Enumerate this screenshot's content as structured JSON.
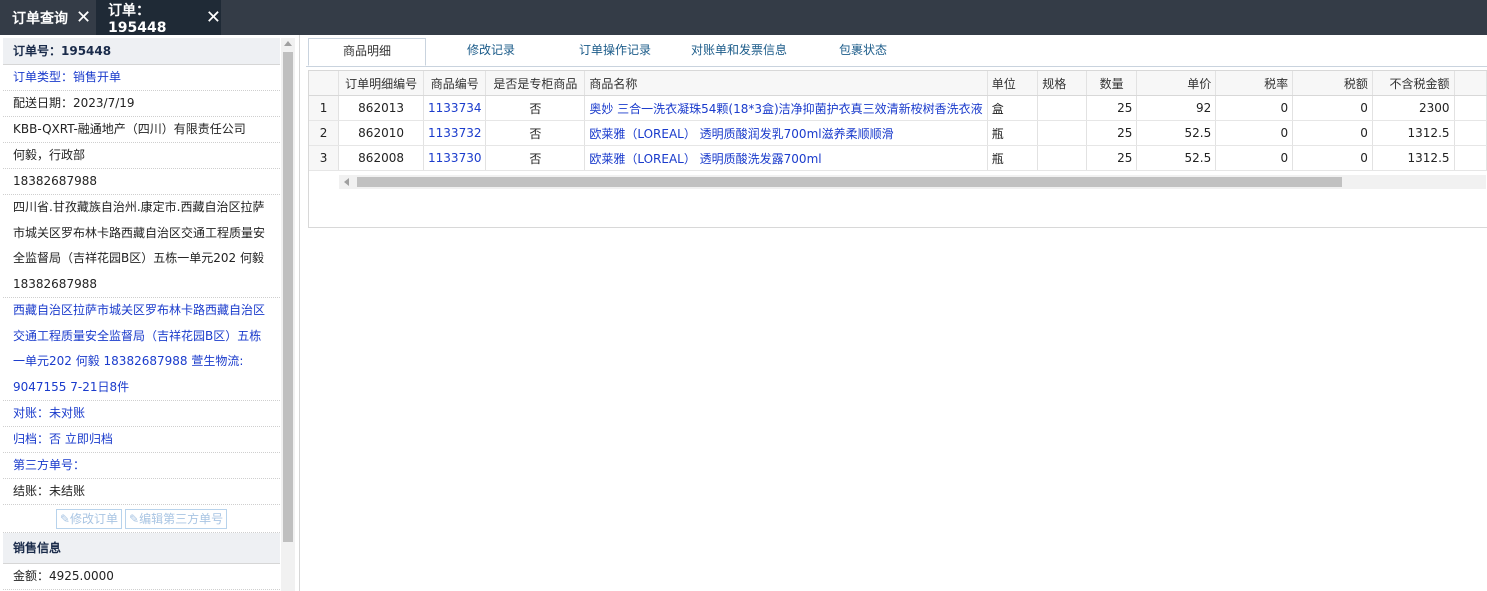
{
  "tabs": [
    {
      "label": "订单查询"
    },
    {
      "label": "订单：195448"
    }
  ],
  "sidebar": {
    "header": "订单号：195448",
    "order_type": "订单类型：销售开单",
    "delivery_date": "配送日期：2023/7/19",
    "company": "KBB-QXRT-融通地产（四川）有限责任公司",
    "contact": "何毅，行政部",
    "phone": "18382687988",
    "address_lines": [
      "四川省.甘孜藏族自治州.康定市.西藏自治区拉萨",
      "市城关区罗布林卡路西藏自治区交通工程质量安",
      "全监督局（吉祥花园B区）五栋一单元202 何毅",
      "18382687988"
    ],
    "remark_lines": [
      "西藏自治区拉萨市城关区罗布林卡路西藏自治区",
      "交通工程质量安全监督局（吉祥花园B区）五栋",
      "一单元202 何毅 18382687988 萱生物流:",
      "9047155 7-21日8件"
    ],
    "reconcile": "对账：未对账",
    "archive": "归档：否 立即归档",
    "third_party": "第三方单号：",
    "settle": "结账：未结账",
    "edit_order_btn": "修改订单",
    "edit_third_btn": "编辑第三方单号",
    "sales_section": "销售信息",
    "amount": "金额：4925.0000"
  },
  "panel_tabs": [
    {
      "label": "商品明细"
    },
    {
      "label": "修改记录"
    },
    {
      "label": "订单操作记录"
    },
    {
      "label": "对账单和发票信息"
    },
    {
      "label": "包裹状态"
    }
  ],
  "table": {
    "headers": [
      "",
      "订单明细编号",
      "商品编号",
      "是否是专柜商品",
      "商品名称",
      "单位",
      "规格",
      "数量",
      "单价",
      "税率",
      "税额",
      "不含税金额"
    ],
    "rows": [
      [
        "1",
        "862013",
        "1133734",
        "否",
        "奥妙 三合一洗衣凝珠54颗(18*3盒)洁净抑菌护衣真三效清新桉树香洗衣液",
        "盒",
        "",
        "25",
        "92",
        "0",
        "0",
        "2300"
      ],
      [
        "2",
        "862010",
        "1133732",
        "否",
        "欧莱雅（LOREAL） 透明质酸润发乳700ml滋养柔顺顺滑",
        "瓶",
        "",
        "25",
        "52.5",
        "0",
        "0",
        "1312.5"
      ],
      [
        "3",
        "862008",
        "1133730",
        "否",
        "欧莱雅（LOREAL） 透明质酸洗发露700ml",
        "瓶",
        "",
        "25",
        "52.5",
        "0",
        "0",
        "1312.5"
      ]
    ]
  },
  "colors": {
    "topbar": "#343c47",
    "active_tab": "#1f2a36",
    "link": "#1a3bcc",
    "tab_text": "#1c5c8a"
  },
  "icons": {
    "close": "close-icon",
    "edit": "edit-icon"
  }
}
